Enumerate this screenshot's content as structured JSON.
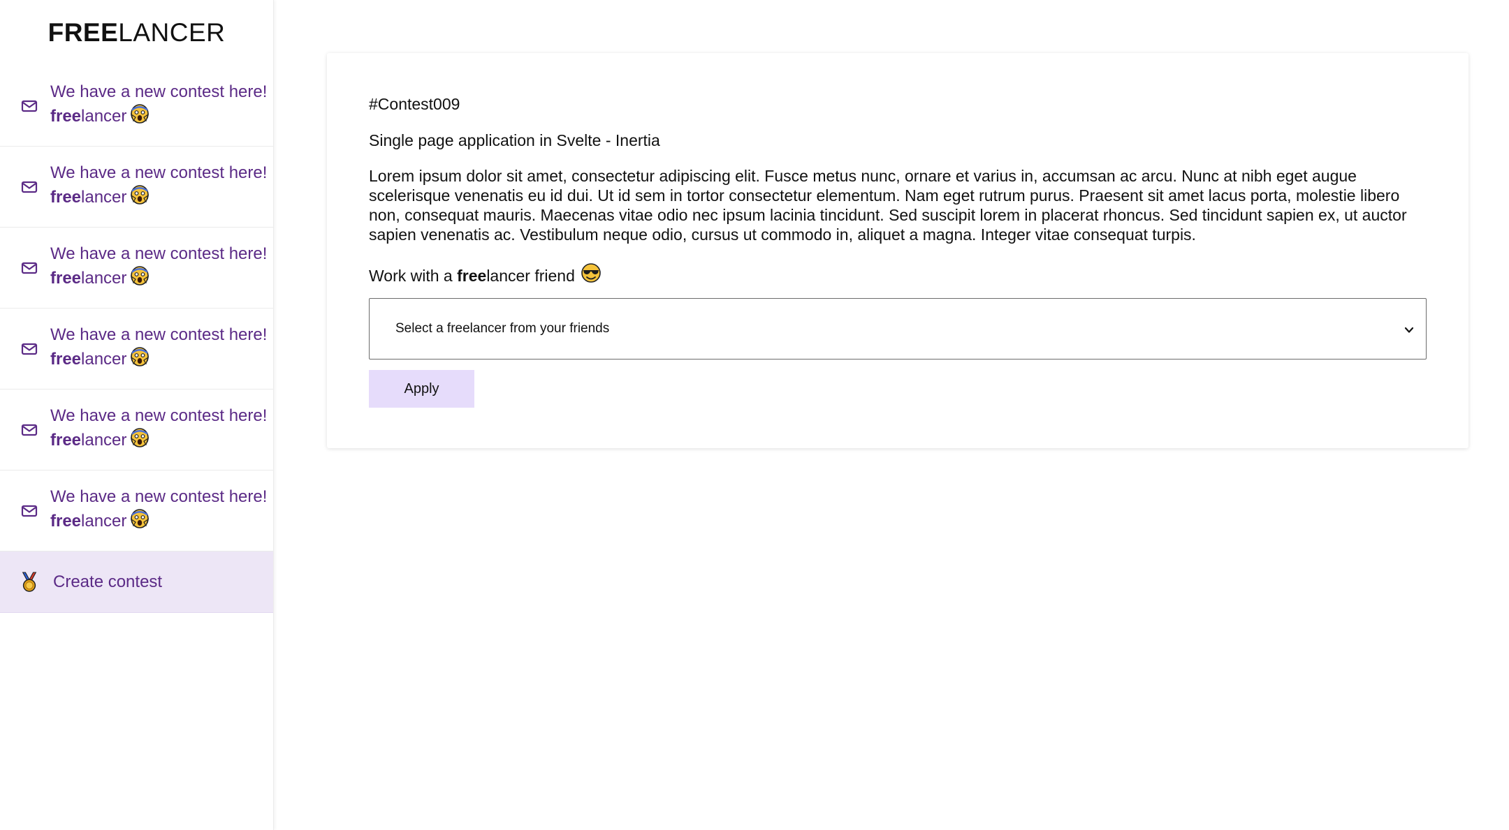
{
  "brand": {
    "strong": "FREE",
    "light": "LANCER"
  },
  "sidebar": {
    "notifications": [
      {
        "prefix": "We have a new contest here! ",
        "highlight": "free",
        "suffix": "lancer",
        "icon": "mail-icon",
        "emoji": "face-screaming-emoji"
      },
      {
        "prefix": "We have a new contest here! ",
        "highlight": "free",
        "suffix": "lancer",
        "icon": "mail-icon",
        "emoji": "face-screaming-emoji"
      },
      {
        "prefix": "We have a new contest here! ",
        "highlight": "free",
        "suffix": "lancer",
        "icon": "mail-icon",
        "emoji": "face-screaming-emoji"
      },
      {
        "prefix": "We have a new contest here! ",
        "highlight": "free",
        "suffix": "lancer",
        "icon": "mail-icon",
        "emoji": "face-screaming-emoji"
      },
      {
        "prefix": "We have a new contest here! ",
        "highlight": "free",
        "suffix": "lancer",
        "icon": "mail-icon",
        "emoji": "face-screaming-emoji"
      },
      {
        "prefix": "We have a new contest here! ",
        "highlight": "free",
        "suffix": "lancer",
        "icon": "mail-icon",
        "emoji": "face-screaming-emoji"
      }
    ],
    "create": {
      "label": "Create contest",
      "icon": "medal-icon"
    }
  },
  "contest": {
    "id": "#Contest009",
    "title": "Single page application in Svelte - Inertia",
    "description": "Lorem ipsum dolor sit amet, consectetur adipiscing elit. Fusce metus nunc, ornare et varius in, accumsan ac arcu. Nunc at nibh eget augue scelerisque venenatis eu id dui. Ut id sem in tortor consectetur elementum. Nam eget rutrum purus. Praesent sit amet lacus porta, molestie libero non, consequat mauris. Maecenas vitae odio nec ipsum lacinia tincidunt. Sed suscipit lorem in placerat rhoncus. Sed tincidunt sapien ex, ut auctor sapien venenatis ac. Vestibulum neque odio, cursus ut commodo in, aliquet a magna. Integer vitae consequat turpis.",
    "work_prefix": "Work with a ",
    "work_highlight": "free",
    "work_suffix": "lancer friend",
    "work_emoji": "sunglasses-face-emoji",
    "select_value": "Select a freelancer from your friends",
    "apply_label": "Apply"
  },
  "colors": {
    "accent_text": "#5b2a86",
    "active_bg": "#ede6f6",
    "button_bg": "#e6dcfb"
  }
}
